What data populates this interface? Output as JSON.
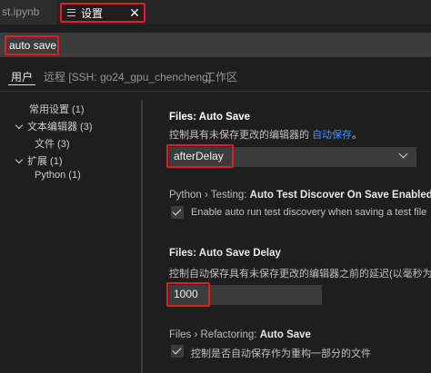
{
  "tabs": {
    "inactive_label": "st.ipynb",
    "active_label": "设置",
    "close_glyph": "✕"
  },
  "search": {
    "value": "auto save"
  },
  "scopes": {
    "user": "用户",
    "remote": "远程 [SSH: go24_gpu_chencheng]",
    "workspace": "工作区"
  },
  "toc": {
    "common": "常用设置 (1)",
    "text_editor": "文本编辑器 (3)",
    "files": "文件 (3)",
    "extensions": "扩展 (1)",
    "python": "Python (1)"
  },
  "settings": {
    "auto_save": {
      "title": "Files: Auto Save",
      "desc_prefix": "控制具有未保存更改的编辑器的 ",
      "desc_link": "自动保存",
      "desc_suffix": "。",
      "value": "afterDelay"
    },
    "test_discover": {
      "title_prefix": "Python › Testing: ",
      "title_key": "Auto Test Discover On Save Enabled",
      "desc": "Enable auto run test discovery when saving a test file.",
      "checked": true
    },
    "auto_save_delay": {
      "title": "Files: Auto Save Delay",
      "desc": "控制自动保存具有未保存更改的编辑器之前的延迟(以毫秒为",
      "value": "1000"
    },
    "refactor_auto_save": {
      "title_prefix": "Files › Refactoring: ",
      "title_key": "Auto Save",
      "desc": "控制是否自动保存作为重构一部分的文件",
      "checked": true
    }
  },
  "colors": {
    "highlight_border": "#e02020",
    "link": "#3794ff",
    "background": "#1e1e1e"
  }
}
